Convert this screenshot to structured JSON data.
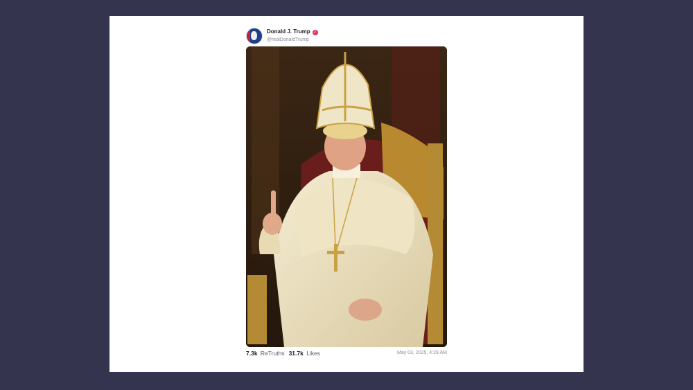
{
  "post": {
    "display_name": "Donald J. Trump",
    "handle": "@realDonaldTrump",
    "verified_icon": "verified-badge-icon",
    "image_alt": "Papal portrait image",
    "stats": {
      "retruths_count": "7.3k",
      "retruths_label": "ReTruths",
      "likes_count": "31.7k",
      "likes_label": "Likes"
    },
    "timestamp": "May 03, 2025, 4:29 AM"
  },
  "colors": {
    "background": "#35344e",
    "card": "#ffffff",
    "verified": "#e5325c"
  }
}
